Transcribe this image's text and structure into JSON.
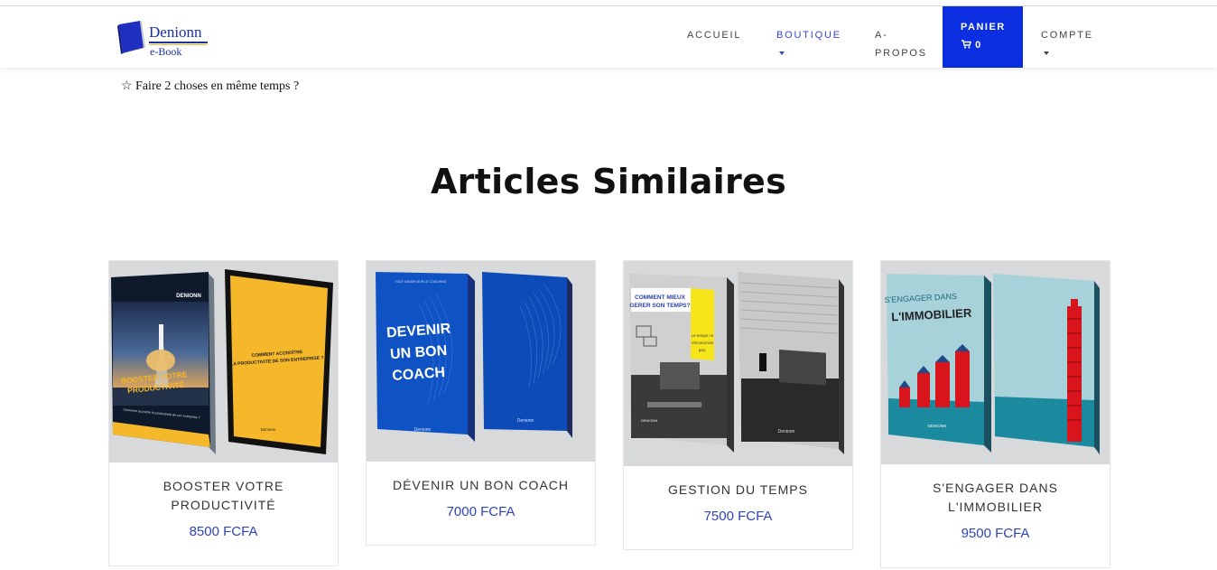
{
  "brand": {
    "name": "Denionn",
    "sub": "e-Book",
    "color": "#1a2fa8"
  },
  "nav": {
    "items": [
      "ACCUEIL",
      "BOUTIQUE",
      "A-PROPOS",
      "COMPTE"
    ],
    "accueil": "ACCUEIL",
    "boutique": "BOUTIQUE",
    "apropos_1": "A-",
    "apropos_2": "PROPOS",
    "panier": "PANIER",
    "cart_count": "0",
    "compte": "COMPTE",
    "cart_color": "#0a2ee0"
  },
  "related_item": "☆ Faire 2 choses en même temps ?",
  "section_title": "Articles Similaires",
  "products": [
    {
      "name_1": "BOOSTER VOTRE",
      "name_2": "PRODUCTIVITÉ",
      "price": "8500 FCFA",
      "cover_front": {
        "brand": "DENIONN",
        "title_1": "BOOSTER VOTRE",
        "title_2": "PRODUCTIVITÉ",
        "tagline": "Comment accroître la productivité de son entreprise ?",
        "footer": "Denionn"
      },
      "cover_back": {
        "title_1": "COMMENT ACCROÎTRE",
        "title_2": "LA PRODUCTIVITÉ DE SON ENTREPRISE ?",
        "footer": "Denionn"
      }
    },
    {
      "name_1": "DÉVENIR UN BON COACH",
      "price": "7000 FCFA",
      "cover_front": {
        "top": "TOUT SAVOIR SUR LE COACHING",
        "title_1": "DEVENIR",
        "title_2": "UN BON",
        "title_3": "COACH",
        "footer": "Denionn"
      },
      "cover_back": {
        "footer": "Denionn"
      }
    },
    {
      "name_1": "GESTION DU TEMPS",
      "price": "7500 FCFA",
      "cover_front": {
        "title_1": "COMMENT MIEUX",
        "title_2": "GERER SON TEMPS?",
        "note_1": "Le temps ne",
        "note_2": "s'économise",
        "note_3": "pas.",
        "footer": "DENIONN"
      },
      "cover_back": {
        "footer": "Denionn"
      }
    },
    {
      "name_1": "S'ENGAGER DANS",
      "name_2": "L'IMMOBILIER",
      "price": "9500 FCFA",
      "cover_front": {
        "title_1": "S'ENGAGER DANS",
        "title_2": "L'IMMOBILIER",
        "footer": "DENIONN"
      },
      "cover_back": {}
    }
  ]
}
